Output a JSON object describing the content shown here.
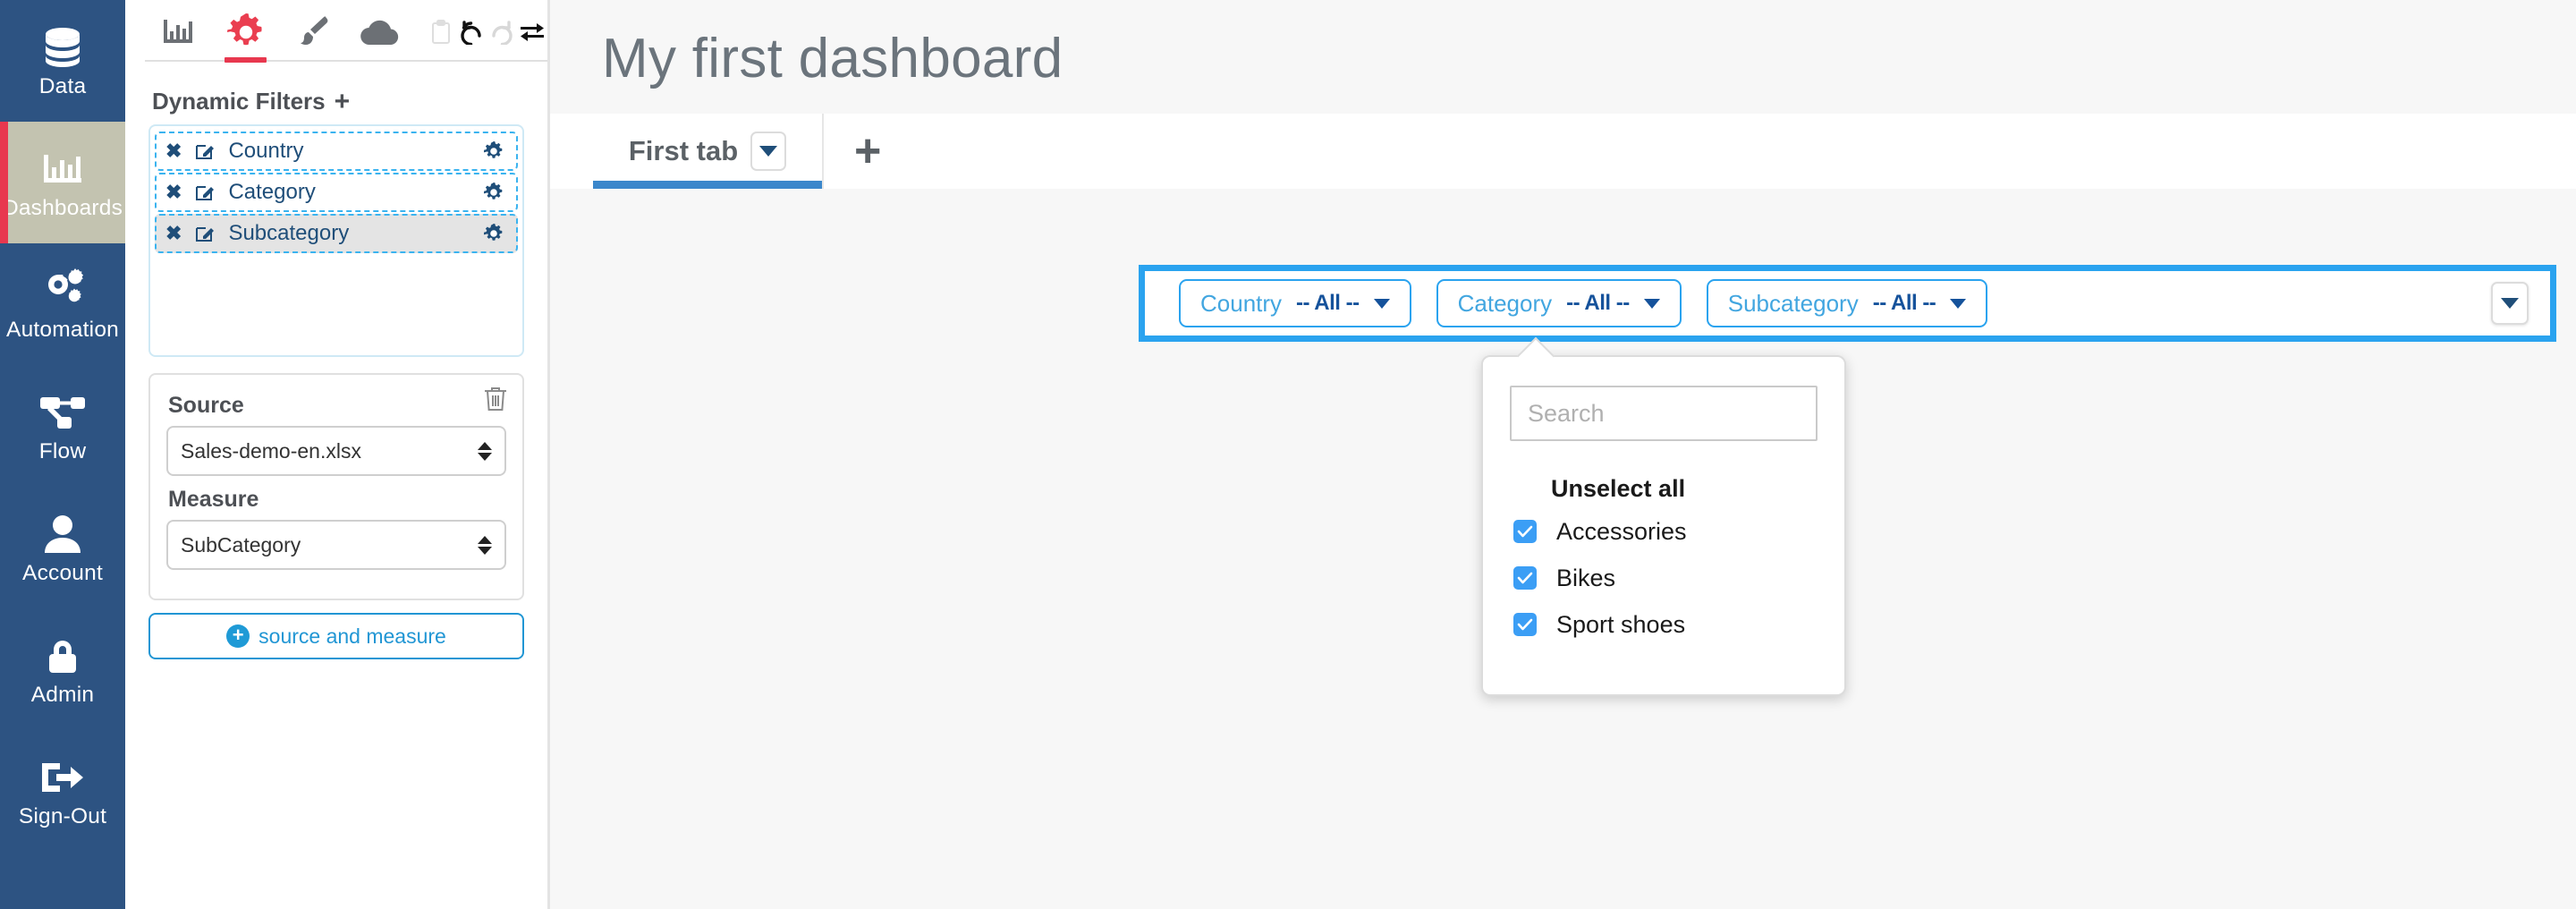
{
  "sidebar": {
    "items": [
      {
        "label": "Data",
        "icon": "database-icon",
        "active": false
      },
      {
        "label": "Dashboards",
        "icon": "bar-chart-icon",
        "active": true
      },
      {
        "label": "Automation",
        "icon": "gears-icon",
        "active": false
      },
      {
        "label": "Flow",
        "icon": "flow-icon",
        "active": false
      },
      {
        "label": "Account",
        "icon": "user-icon",
        "active": false
      },
      {
        "label": "Admin",
        "icon": "lock-icon",
        "active": false
      },
      {
        "label": "Sign-Out",
        "icon": "sign-out-icon",
        "active": false
      }
    ],
    "bg_color": "#2d5382",
    "active_bg_color": "#c3c3b0",
    "active_accent_color": "#e8384f"
  },
  "panel": {
    "toolbar": [
      {
        "name": "chart-icon",
        "state": "normal"
      },
      {
        "name": "gear-icon",
        "state": "active"
      },
      {
        "name": "paintbrush-icon",
        "state": "normal"
      },
      {
        "name": "cloud-icon",
        "state": "normal"
      },
      {
        "name": "clipboard-icon",
        "state": "disabled"
      },
      {
        "name": "undo-icon",
        "state": "normal"
      },
      {
        "name": "redo-icon",
        "state": "disabled"
      },
      {
        "name": "swap-icon",
        "state": "normal"
      }
    ],
    "dynamic_filters": {
      "title": "Dynamic Filters",
      "add_label": "+",
      "items": [
        {
          "label": "Country",
          "highlighted": false
        },
        {
          "label": "Category",
          "highlighted": false
        },
        {
          "label": "Subcategory",
          "highlighted": true
        }
      ]
    },
    "source_card": {
      "source_label": "Source",
      "source_value": "Sales-demo-en.xlsx",
      "measure_label": "Measure",
      "measure_value": "SubCategory"
    },
    "add_button_label": "source and measure"
  },
  "main": {
    "title": "My first dashboard",
    "tabs": [
      {
        "label": "First tab",
        "active": true
      }
    ],
    "add_tab_label": "+",
    "filters": [
      {
        "name": "Country",
        "value": "-- All --"
      },
      {
        "name": "Category",
        "value": "-- All --"
      },
      {
        "name": "Subcategory",
        "value": "-- All --"
      }
    ],
    "accent_color": "#2aa3ef",
    "dropdown": {
      "search_placeholder": "Search",
      "search_value": "",
      "unselect_all_label": "Unselect all",
      "options": [
        {
          "label": "Accessories",
          "checked": true
        },
        {
          "label": "Bikes",
          "checked": true
        },
        {
          "label": "Sport shoes",
          "checked": true
        }
      ]
    }
  }
}
